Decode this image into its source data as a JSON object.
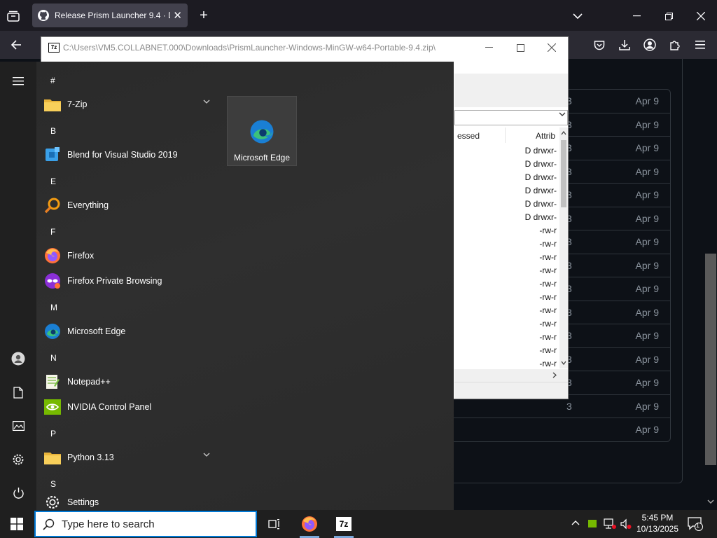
{
  "browser": {
    "tab_title": "Release Prism Launcher 9.4 · Di",
    "new_tab_symbol": "+",
    "colors": {
      "chrome_bg": "#1c1b22",
      "toolbar_bg": "#2b2a33",
      "tab_bg": "#42414d",
      "page_bg": "#0d1117"
    }
  },
  "assets": {
    "rows": [
      {
        "tail": "3",
        "date": "Apr 9"
      },
      {
        "tail": "3",
        "date": "Apr 9"
      },
      {
        "tail": "3",
        "date": "Apr 9"
      },
      {
        "tail": "3",
        "date": "Apr 9"
      },
      {
        "tail": "3",
        "date": "Apr 9"
      },
      {
        "tail": "3",
        "date": "Apr 9"
      },
      {
        "tail": "3",
        "date": "Apr 9"
      },
      {
        "tail": "3",
        "date": "Apr 9"
      },
      {
        "tail": "3",
        "date": "Apr 9"
      },
      {
        "tail": "3",
        "date": "Apr 9"
      },
      {
        "tail": "3",
        "date": "Apr 9"
      },
      {
        "tail": "3",
        "date": "Apr 9"
      },
      {
        "tail": "3",
        "date": "Apr 9"
      },
      {
        "tail": "3",
        "date": "Apr 9"
      },
      {
        "tail": "",
        "date": "Apr 9"
      }
    ]
  },
  "sevenzip": {
    "logo_text": "7z",
    "title": "C:\\Users\\VM5.COLLABNET.000\\Downloads\\PrismLauncher-Windows-MinGW-w64-Portable-9.4.zip\\",
    "columns": {
      "packed": "essed",
      "attributes": "Attrib"
    },
    "attributes": [
      "D drwxr-",
      "D drwxr-",
      "D drwxr-",
      "D drwxr-",
      "D drwxr-",
      "D drwxr-",
      "-rw-r",
      "-rw-r",
      "-rw-r",
      "-rw-r",
      "-rw-r",
      "-rw-r",
      "-rw-r",
      "-rw-r",
      "-rw-r",
      "-rw-r",
      "-rw-r"
    ]
  },
  "start_menu": {
    "letters": {
      "hash": "#",
      "b": "B",
      "e": "E",
      "f": "F",
      "m": "M",
      "n": "N",
      "p": "P",
      "s": "S"
    },
    "apps": {
      "seven_zip": "7-Zip",
      "blend": "Blend for Visual Studio 2019",
      "everything": "Everything",
      "firefox": "Firefox",
      "firefox_private": "Firefox Private Browsing",
      "edge": "Microsoft Edge",
      "notepadpp": "Notepad++",
      "nvidia": "NVIDIA Control Panel",
      "python": "Python 3.13",
      "settings": "Settings"
    },
    "tile_label": "Microsoft Edge"
  },
  "taskbar": {
    "search_placeholder": "Type here to search",
    "seven_zip_label": "7z",
    "time": "5:45 PM",
    "date": "10/13/2025",
    "notification_count": "1",
    "accent": "#0078d4"
  }
}
